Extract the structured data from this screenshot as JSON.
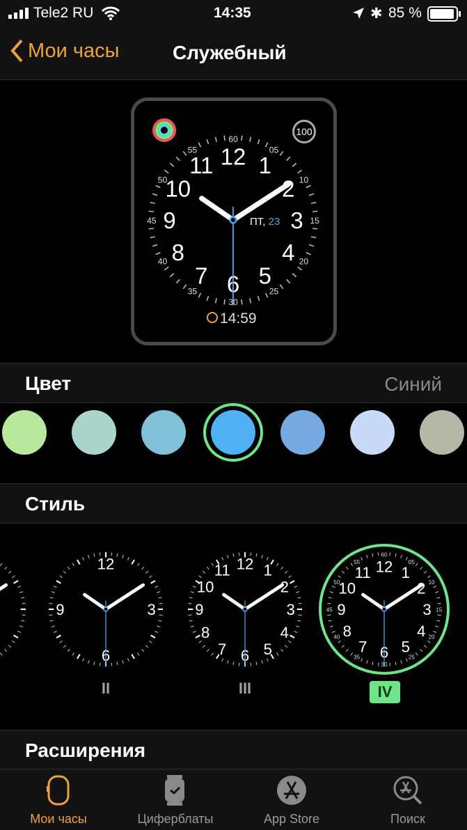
{
  "status": {
    "carrier": "Tele2 RU",
    "time": "14:35",
    "battery": "85 %",
    "icons": [
      "signal-icon",
      "wifi-icon",
      "location-icon",
      "bluetooth-icon",
      "battery-icon"
    ]
  },
  "nav": {
    "back_label": "Мои часы",
    "title": "Служебный"
  },
  "face": {
    "complication_top_right": "100",
    "date_day": "ПТ,",
    "date_num": "23",
    "timer": "14:59",
    "accent": "#4aa8f0",
    "clock_time": "10:09:30"
  },
  "color": {
    "label": "Цвет",
    "value": "Синий",
    "swatches": [
      "#b9e89d",
      "#a9d5cc",
      "#80c1d8",
      "#4fb0f4",
      "#76a9e2",
      "#c7dbf8",
      "#b5b8a6"
    ],
    "selected_index": 3,
    "selection_color": "#6ee58a"
  },
  "style": {
    "label": "Стиль",
    "options": [
      "II",
      "III",
      "IV"
    ],
    "selected": "IV"
  },
  "extensions": {
    "label": "Расширения"
  },
  "tabs": [
    {
      "label": "Мои часы",
      "icon": "watch-icon",
      "active": true
    },
    {
      "label": "Циферблаты",
      "icon": "watch-face-icon"
    },
    {
      "label": "App Store",
      "icon": "app-store-icon"
    },
    {
      "label": "Поиск",
      "icon": "search-icon"
    }
  ]
}
